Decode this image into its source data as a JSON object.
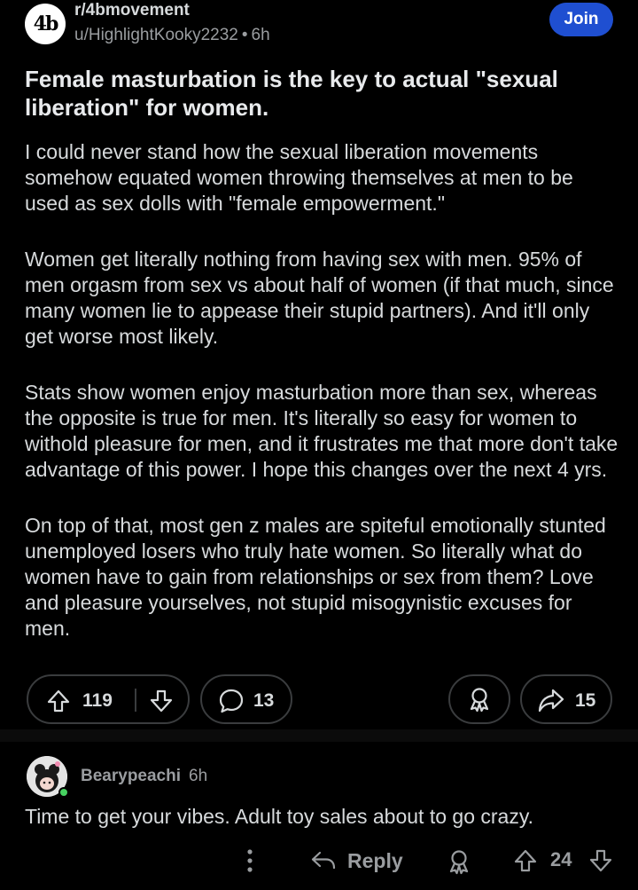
{
  "post": {
    "subreddit": "r/4bmovement",
    "subreddit_avatar_text": "4b",
    "author": "u/HighlightKooky2232",
    "separator": "•",
    "time": "6h",
    "join_label": "Join",
    "title": "Female masturbation is the key to actual \"sexual liberation\" for women.",
    "paragraphs": [
      "I could never stand how the sexual liberation movements somehow equated women throwing themselves at men to be used as sex dolls with \"female empowerment.\"",
      "Women get literally nothing from having sex with men. 95% of men orgasm from sex vs about half of women (if that much, since many women lie to appease their stupid partners). And it'll only get worse most likely.",
      "Stats show women enjoy masturbation more than sex, whereas the opposite is true for men. It's literally so easy for women to withold pleasure for men, and it frustrates me that more don't take advantage of this power. I hope this changes over the next 4 yrs.",
      "On top of that, most gen z males are spiteful emotionally stunted unemployed losers who truly hate women. So literally what do women have to gain from relationships or sex from them? Love and pleasure yourselves, not stupid misogynistic excuses for men."
    ],
    "actions": {
      "upvotes": "119",
      "comments": "13",
      "shares": "15"
    }
  },
  "comment": {
    "author": "Bearypeachi",
    "time": "6h",
    "text": "Time to get your vibes. Adult toy sales about to go crazy.",
    "reply_label": "Reply",
    "score": "24"
  },
  "colors": {
    "background": "#000000",
    "join_button": "#1f4fd1",
    "online_indicator": "#46d160",
    "text": "#d7dadc",
    "muted": "#9a9da0"
  }
}
